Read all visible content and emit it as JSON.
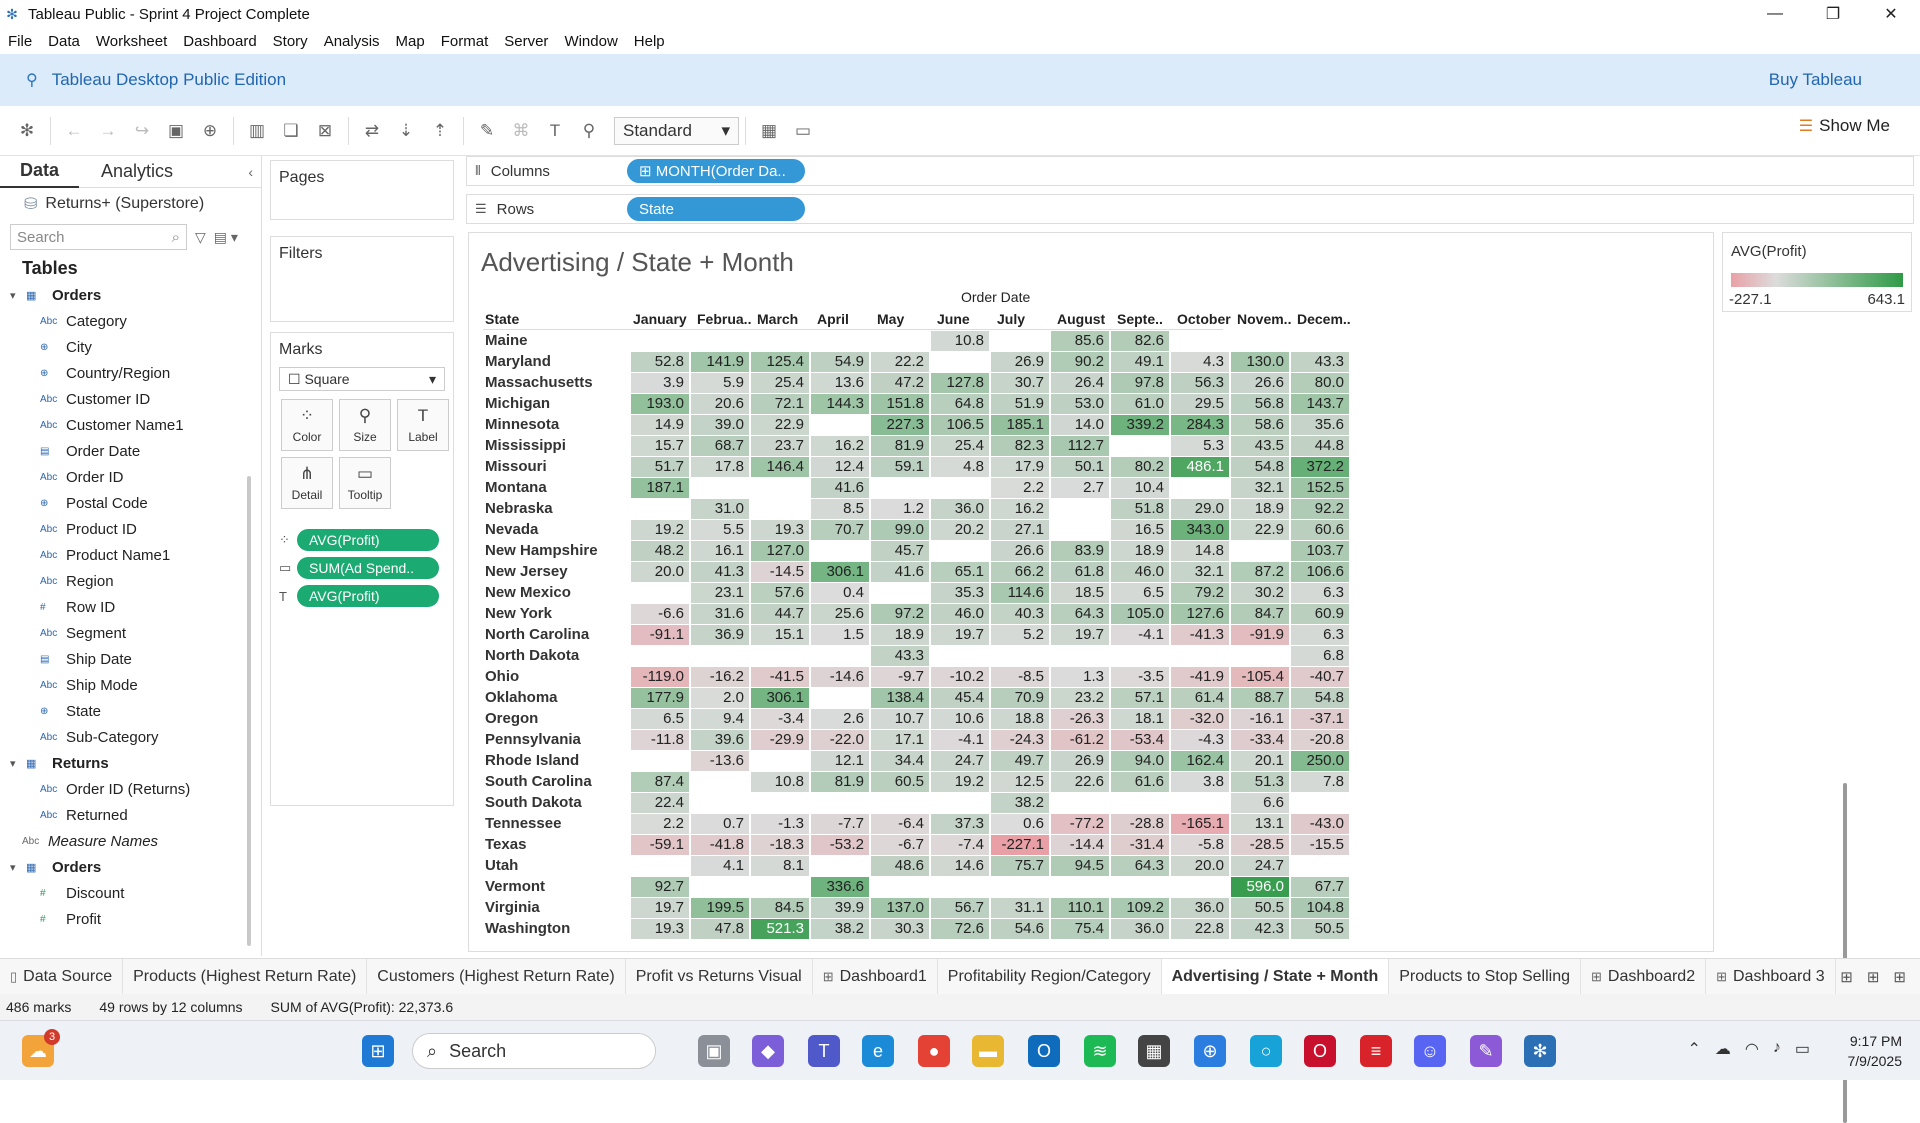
{
  "window": {
    "title": "Tableau Public - Sprint 4 Project Complete"
  },
  "menu": [
    "File",
    "Data",
    "Worksheet",
    "Dashboard",
    "Story",
    "Analysis",
    "Map",
    "Format",
    "Server",
    "Window",
    "Help"
  ],
  "edition": {
    "label": "Tableau Desktop Public Edition",
    "buy": "Buy Tableau"
  },
  "toolbar": {
    "fit": "Standard",
    "show_me": "Show Me"
  },
  "left": {
    "tab_data": "Data",
    "tab_analytics": "Analytics",
    "source": "Returns+ (Superstore)",
    "search_placeholder": "Search",
    "tables_heading": "Tables",
    "fields": [
      {
        "kind": "table",
        "label": "Orders"
      },
      {
        "kind": "dim",
        "type": "Abc",
        "label": "Category"
      },
      {
        "kind": "dim",
        "type": "⊕",
        "label": "City"
      },
      {
        "kind": "dim",
        "type": "⊕",
        "label": "Country/Region"
      },
      {
        "kind": "dim",
        "type": "Abc",
        "label": "Customer ID"
      },
      {
        "kind": "dim",
        "type": "Abc",
        "label": "Customer Name1"
      },
      {
        "kind": "dim",
        "type": "▤",
        "label": "Order Date"
      },
      {
        "kind": "dim",
        "type": "Abc",
        "label": "Order ID"
      },
      {
        "kind": "dim",
        "type": "⊕",
        "label": "Postal Code"
      },
      {
        "kind": "dim",
        "type": "Abc",
        "label": "Product ID"
      },
      {
        "kind": "dim",
        "type": "Abc",
        "label": "Product Name1"
      },
      {
        "kind": "dim",
        "type": "Abc",
        "label": "Region"
      },
      {
        "kind": "dim",
        "type": "#",
        "label": "Row ID"
      },
      {
        "kind": "dim",
        "type": "Abc",
        "label": "Segment"
      },
      {
        "kind": "dim",
        "type": "▤",
        "label": "Ship Date"
      },
      {
        "kind": "dim",
        "type": "Abc",
        "label": "Ship Mode"
      },
      {
        "kind": "dim",
        "type": "⊕",
        "label": "State"
      },
      {
        "kind": "dim",
        "type": "Abc",
        "label": "Sub-Category"
      },
      {
        "kind": "table",
        "label": "Returns"
      },
      {
        "kind": "dim",
        "type": "Abc",
        "label": "Order ID (Returns)"
      },
      {
        "kind": "dim",
        "type": "Abc",
        "label": "Returned"
      },
      {
        "kind": "mn",
        "type": "Abc",
        "label": "Measure Names"
      },
      {
        "kind": "table",
        "label": "Orders"
      },
      {
        "kind": "meas",
        "type": "#",
        "label": "Discount"
      },
      {
        "kind": "meas",
        "type": "#",
        "label": "Profit"
      }
    ]
  },
  "cards": {
    "pages": "Pages",
    "filters": "Filters",
    "marks": "Marks",
    "mark_type": "Square",
    "mark_buttons": [
      {
        "icon": "⁘",
        "label": "Color"
      },
      {
        "icon": "⚲",
        "label": "Size"
      },
      {
        "icon": "T",
        "label": "Label"
      },
      {
        "icon": "⋔",
        "label": "Detail"
      },
      {
        "icon": "▭",
        "label": "Tooltip"
      }
    ],
    "mark_pills": [
      {
        "icon": "⁘",
        "label": "AVG(Profit)"
      },
      {
        "icon": "▭",
        "label": "SUM(Ad Spend.."
      },
      {
        "icon": "T",
        "label": "AVG(Profit)"
      }
    ]
  },
  "shelves": {
    "columns_label": "Columns",
    "columns_pill": "⊞ MONTH(Order Da..",
    "rows_label": "Rows",
    "rows_pill": "State"
  },
  "view": {
    "title": "Advertising / State + Month",
    "column_group": "Order Date",
    "state_header": "State",
    "months": [
      "January",
      "Februa..",
      "March",
      "April",
      "May",
      "June",
      "July",
      "August",
      "Septe..",
      "October",
      "Novem..",
      "Decem.."
    ],
    "rows": [
      {
        "state": "Maine",
        "values": [
          null,
          null,
          null,
          null,
          null,
          "10.8",
          null,
          "85.6",
          "82.6",
          null,
          null,
          null
        ]
      },
      {
        "state": "Maryland",
        "values": [
          "52.8",
          "141.9",
          "125.4",
          "54.9",
          "22.2",
          null,
          "26.9",
          "90.2",
          "49.1",
          "4.3",
          "130.0",
          "43.3"
        ]
      },
      {
        "state": "Massachusetts",
        "values": [
          "3.9",
          "5.9",
          "25.4",
          "13.6",
          "47.2",
          "127.8",
          "30.7",
          "26.4",
          "97.8",
          "56.3",
          "26.6",
          "80.0"
        ]
      },
      {
        "state": "Michigan",
        "values": [
          "193.0",
          "20.6",
          "72.1",
          "144.3",
          "151.8",
          "64.8",
          "51.9",
          "53.0",
          "61.0",
          "29.5",
          "56.8",
          "143.7"
        ]
      },
      {
        "state": "Minnesota",
        "values": [
          "14.9",
          "39.0",
          "22.9",
          null,
          "227.3",
          "106.5",
          "185.1",
          "14.0",
          "339.2",
          "284.3",
          "58.6",
          "35.6"
        ]
      },
      {
        "state": "Mississippi",
        "values": [
          "15.7",
          "68.7",
          "23.7",
          "16.2",
          "81.9",
          "25.4",
          "82.3",
          "112.7",
          null,
          "5.3",
          "43.5",
          "44.8"
        ]
      },
      {
        "state": "Missouri",
        "values": [
          "51.7",
          "17.8",
          "146.4",
          "12.4",
          "59.1",
          "4.8",
          "17.9",
          "50.1",
          "80.2",
          "486.1",
          "54.8",
          "372.2"
        ]
      },
      {
        "state": "Montana",
        "values": [
          "187.1",
          null,
          null,
          "41.6",
          null,
          null,
          "2.2",
          "2.7",
          "10.4",
          null,
          "32.1",
          "152.5"
        ]
      },
      {
        "state": "Nebraska",
        "values": [
          null,
          "31.0",
          null,
          "8.5",
          "1.2",
          "36.0",
          "16.2",
          null,
          "51.8",
          "29.0",
          "18.9",
          "92.2"
        ]
      },
      {
        "state": "Nevada",
        "values": [
          "19.2",
          "5.5",
          "19.3",
          "70.7",
          "99.0",
          "20.2",
          "27.1",
          null,
          "16.5",
          "343.0",
          "22.9",
          "60.6"
        ]
      },
      {
        "state": "New Hampshire",
        "values": [
          "48.2",
          "16.1",
          "127.0",
          null,
          "45.7",
          null,
          "26.6",
          "83.9",
          "18.9",
          "14.8",
          null,
          "103.7"
        ]
      },
      {
        "state": "New Jersey",
        "values": [
          "20.0",
          "41.3",
          "-14.5",
          "306.1",
          "41.6",
          "65.1",
          "66.2",
          "61.8",
          "46.0",
          "32.1",
          "87.2",
          "106.6"
        ]
      },
      {
        "state": "New Mexico",
        "values": [
          null,
          "23.1",
          "57.6",
          "0.4",
          null,
          "35.3",
          "114.6",
          "18.5",
          "6.5",
          "79.2",
          "30.2",
          "6.3"
        ]
      },
      {
        "state": "New York",
        "values": [
          "-6.6",
          "31.6",
          "44.7",
          "25.6",
          "97.2",
          "46.0",
          "40.3",
          "64.3",
          "105.0",
          "127.6",
          "84.7",
          "60.9"
        ]
      },
      {
        "state": "North Carolina",
        "values": [
          "-91.1",
          "36.9",
          "15.1",
          "1.5",
          "18.9",
          "19.7",
          "5.2",
          "19.7",
          "-4.1",
          "-41.3",
          "-91.9",
          "6.3"
        ]
      },
      {
        "state": "North Dakota",
        "values": [
          null,
          null,
          null,
          null,
          "43.3",
          null,
          null,
          null,
          null,
          null,
          null,
          "6.8"
        ]
      },
      {
        "state": "Ohio",
        "values": [
          "-119.0",
          "-16.2",
          "-41.5",
          "-14.6",
          "-9.7",
          "-10.2",
          "-8.5",
          "1.3",
          "-3.5",
          "-41.9",
          "-105.4",
          "-40.7"
        ]
      },
      {
        "state": "Oklahoma",
        "values": [
          "177.9",
          "2.0",
          "306.1",
          null,
          "138.4",
          "45.4",
          "70.9",
          "23.2",
          "57.1",
          "61.4",
          "88.7",
          "54.8"
        ]
      },
      {
        "state": "Oregon",
        "values": [
          "6.5",
          "9.4",
          "-3.4",
          "2.6",
          "10.7",
          "10.6",
          "18.8",
          "-26.3",
          "18.1",
          "-32.0",
          "-16.1",
          "-37.1"
        ]
      },
      {
        "state": "Pennsylvania",
        "values": [
          "-11.8",
          "39.6",
          "-29.9",
          "-22.0",
          "17.1",
          "-4.1",
          "-24.3",
          "-61.2",
          "-53.4",
          "-4.3",
          "-33.4",
          "-20.8"
        ]
      },
      {
        "state": "Rhode Island",
        "values": [
          null,
          "-13.6",
          null,
          "12.1",
          "34.4",
          "24.7",
          "49.7",
          "26.9",
          "94.0",
          "162.4",
          "20.1",
          "250.0"
        ]
      },
      {
        "state": "South Carolina",
        "values": [
          "87.4",
          null,
          "10.8",
          "81.9",
          "60.5",
          "19.2",
          "12.5",
          "22.6",
          "61.6",
          "3.8",
          "51.3",
          "7.8"
        ]
      },
      {
        "state": "South Dakota",
        "values": [
          "22.4",
          null,
          null,
          null,
          null,
          null,
          "38.2",
          null,
          null,
          null,
          "6.6",
          null
        ]
      },
      {
        "state": "Tennessee",
        "values": [
          "2.2",
          "0.7",
          "-1.3",
          "-7.7",
          "-6.4",
          "37.3",
          "0.6",
          "-77.2",
          "-28.8",
          "-165.1",
          "13.1",
          "-43.0"
        ]
      },
      {
        "state": "Texas",
        "values": [
          "-59.1",
          "-41.8",
          "-18.3",
          "-53.2",
          "-6.7",
          "-7.4",
          "-227.1",
          "-14.4",
          "-31.4",
          "-5.8",
          "-28.5",
          "-15.5"
        ]
      },
      {
        "state": "Utah",
        "values": [
          null,
          "4.1",
          "8.1",
          null,
          "48.6",
          "14.6",
          "75.7",
          "94.5",
          "64.3",
          "20.0",
          "24.7",
          null
        ]
      },
      {
        "state": "Vermont",
        "values": [
          "92.7",
          null,
          null,
          "336.6",
          null,
          null,
          null,
          null,
          null,
          null,
          "596.0",
          "67.7"
        ]
      },
      {
        "state": "Virginia",
        "values": [
          "19.7",
          "199.5",
          "84.5",
          "39.9",
          "137.0",
          "56.7",
          "31.1",
          "110.1",
          "109.2",
          "36.0",
          "50.5",
          "104.8"
        ]
      },
      {
        "state": "Washington",
        "values": [
          "19.3",
          "47.8",
          "521.3",
          "38.2",
          "30.3",
          "72.6",
          "54.6",
          "75.4",
          "36.0",
          "22.8",
          "42.3",
          "50.5"
        ]
      }
    ]
  },
  "legend": {
    "title": "AVG(Profit)",
    "min": "-227.1",
    "max": "643.1",
    "min_value": -227.1,
    "max_value": 643.1,
    "color_negative": "#e8a0a6",
    "color_neutral": "#dcdcdc",
    "color_positive": "#2f9a46"
  },
  "sheet_tabs": [
    {
      "label": "Data Source",
      "icon": "▯"
    },
    {
      "label": "Products (Highest Return Rate)",
      "icon": ""
    },
    {
      "label": "Customers (Highest Return Rate)",
      "icon": ""
    },
    {
      "label": "Profit vs Returns Visual",
      "icon": ""
    },
    {
      "label": "Dashboard1",
      "icon": "⊞"
    },
    {
      "label": "Profitability Region/Category",
      "icon": ""
    },
    {
      "label": "Advertising / State + Month",
      "icon": "",
      "active": true
    },
    {
      "label": "Products to Stop Selling",
      "icon": ""
    },
    {
      "label": "Dashboard2",
      "icon": "⊞"
    },
    {
      "label": "Dashboard 3",
      "icon": "⊞"
    }
  ],
  "status": {
    "marks": "486 marks",
    "dims": "49 rows by 12 columns",
    "sum": "SUM of AVG(Profit): 22,373.6"
  },
  "taskbar": {
    "search": "Search",
    "time": "9:17 PM",
    "date": "7/9/2025",
    "weather_badge": "3"
  }
}
